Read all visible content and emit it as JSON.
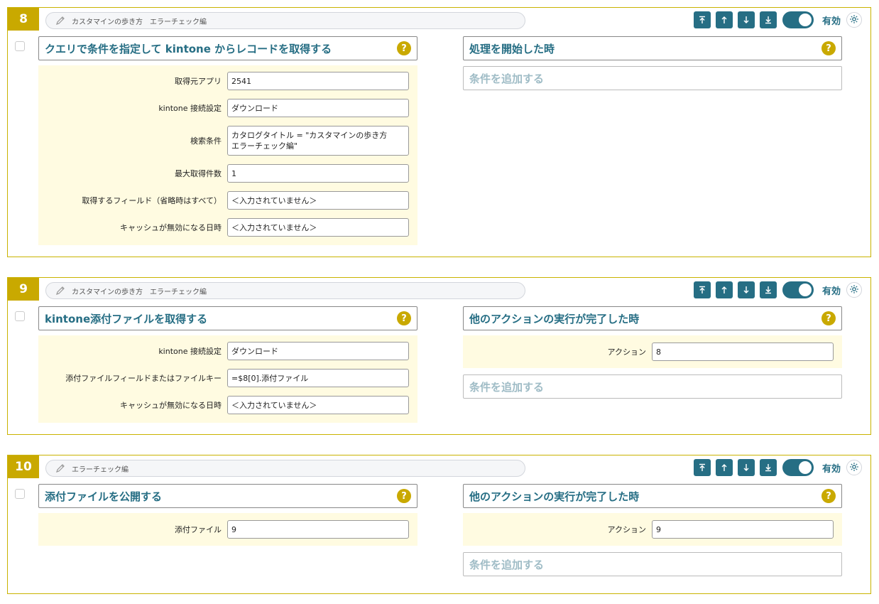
{
  "rules": [
    {
      "number": "8",
      "memo": "カスタマインの歩き方　エラーチェック編",
      "enabled_label": "有効",
      "action": {
        "title": "クエリで条件を指定して kintone からレコードを取得する",
        "params": [
          {
            "label": "取得元アプリ",
            "value": "2541"
          },
          {
            "label": "kintone 接続設定",
            "value": "ダウンロード"
          },
          {
            "label": "検索条件",
            "value": "カタログタイトル = \"カスタマインの歩き方\nエラーチェック編\""
          },
          {
            "label": "最大取得件数",
            "value": "1"
          },
          {
            "label": "取得するフィールド（省略時はすべて）",
            "value": "＜入力されていません＞"
          },
          {
            "label": "キャッシュが無効になる日時",
            "value": "＜入力されていません＞"
          }
        ]
      },
      "trigger": {
        "title": "処理を開始した時",
        "params": []
      },
      "add_condition_label": "条件を追加する"
    },
    {
      "number": "9",
      "memo": "カスタマインの歩き方　エラーチェック編",
      "enabled_label": "有効",
      "action": {
        "title": "kintone添付ファイルを取得する",
        "params": [
          {
            "label": "kintone 接続設定",
            "value": "ダウンロード"
          },
          {
            "label": "添付ファイルフィールドまたはファイルキー",
            "value": "=$8[0].添付ファイル"
          },
          {
            "label": "キャッシュが無効になる日時",
            "value": "＜入力されていません＞"
          }
        ]
      },
      "trigger": {
        "title": "他のアクションの実行が完了した時",
        "params": [
          {
            "label": "アクション",
            "value": "8"
          }
        ]
      },
      "add_condition_label": "条件を追加する"
    },
    {
      "number": "10",
      "memo": "エラーチェック編",
      "enabled_label": "有効",
      "action": {
        "title": "添付ファイルを公開する",
        "params": [
          {
            "label": "添付ファイル",
            "value": "9"
          }
        ]
      },
      "trigger": {
        "title": "他のアクションの実行が完了した時",
        "params": [
          {
            "label": "アクション",
            "value": "9"
          }
        ]
      },
      "add_condition_label": "条件を追加する"
    }
  ],
  "help_glyph": "?",
  "toolbar_icons": [
    "move-top-icon",
    "move-up-icon",
    "move-down-icon",
    "move-bottom-icon"
  ],
  "colors": {
    "accent": "#266e84",
    "gold": "#c9a900",
    "param_bg": "#fffbe1"
  }
}
